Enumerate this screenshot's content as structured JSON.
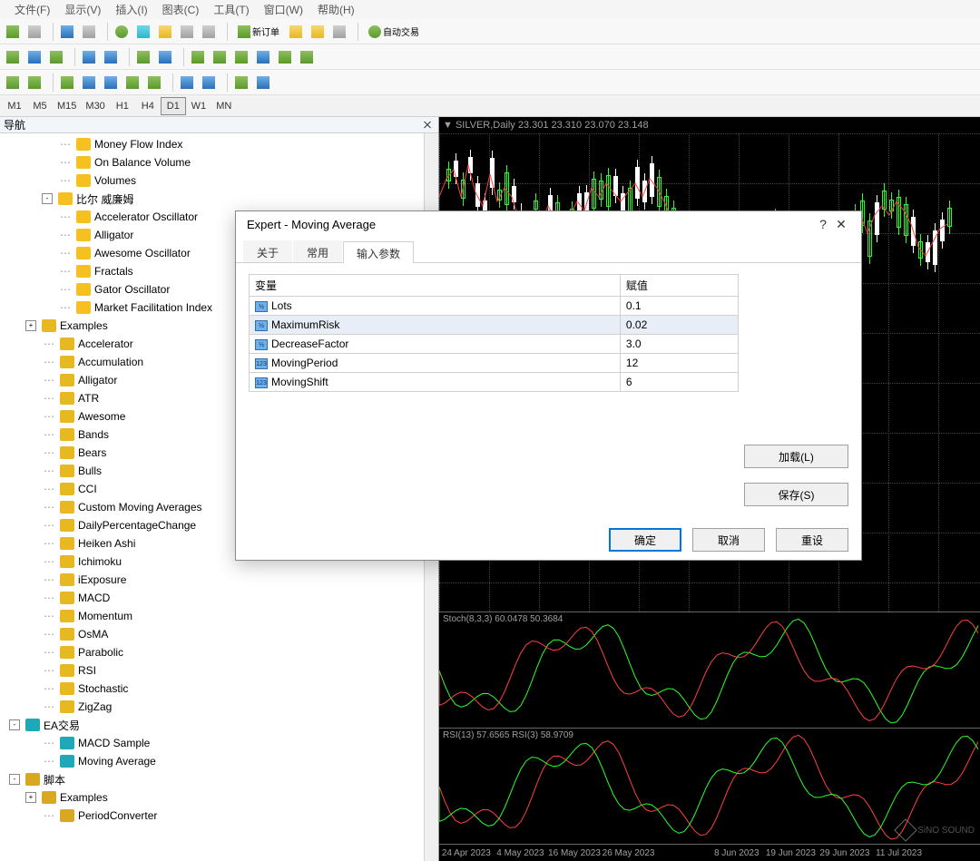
{
  "menu": {
    "items": [
      "文件(F)",
      "显示(V)",
      "插入(I)",
      "图表(C)",
      "工具(T)",
      "窗口(W)",
      "帮助(H)"
    ]
  },
  "toolbar": {
    "row1": [
      {
        "name": "new-chart-icon",
        "glyph": "greenish"
      },
      {
        "name": "dropdown-icon",
        "glyph": "grayish"
      },
      {
        "sep": true
      },
      {
        "name": "save-icon",
        "glyph": "bluish"
      },
      {
        "name": "dropdown2-icon",
        "glyph": "grayish"
      },
      {
        "sep": true
      },
      {
        "name": "profile-icon",
        "glyph": "greenish"
      },
      {
        "name": "marketwatch-icon",
        "glyph": "cyanish"
      },
      {
        "name": "navigator-icon",
        "glyph": "yellowish"
      },
      {
        "name": "terminal-icon",
        "glyph": "grayish"
      },
      {
        "name": "tester-icon",
        "glyph": "grayish"
      },
      {
        "sep": true
      },
      {
        "name": "new-order-icon",
        "glyph": "greenish",
        "label": "新订单"
      },
      {
        "name": "meta-editor-icon",
        "glyph": "yellowish"
      },
      {
        "name": "options-icon",
        "glyph": "yellowish"
      },
      {
        "name": "fullscreen-icon",
        "glyph": "grayish"
      },
      {
        "sep": true
      },
      {
        "name": "autotrade-icon",
        "glyph": "greenish",
        "label": "自动交易"
      }
    ],
    "row2_names": [
      "bar-chart-icon",
      "candle-chart-icon",
      "line-chart-icon",
      "sep",
      "zoom-in-icon",
      "zoom-out-icon",
      "sep",
      "auto-scroll-icon",
      "shift-icon",
      "sep",
      "indicators-icon",
      "periods-icon",
      "templates-icon",
      "dd1",
      "dd2",
      "dd3"
    ],
    "row3_names": [
      "cursor-icon",
      "crosshair-icon",
      "sep2",
      "vline-icon",
      "hline-icon",
      "trendline-icon",
      "equidistant-icon",
      "fibo-icon",
      "sep2",
      "text-icon",
      "textlabel-icon",
      "sep2",
      "arrows-icon",
      "dd"
    ]
  },
  "timeframes": {
    "items": [
      "M1",
      "M5",
      "M15",
      "M30",
      "H1",
      "H4",
      "D1",
      "W1",
      "MN"
    ],
    "active": "D1"
  },
  "nav": {
    "title": "导航",
    "groups": [
      {
        "depth": 3,
        "icon": "f-yellow",
        "label": "Money Flow Index"
      },
      {
        "depth": 3,
        "icon": "f-yellow",
        "label": "On Balance Volume"
      },
      {
        "depth": 3,
        "icon": "f-yellow",
        "label": "Volumes"
      },
      {
        "depth": 2,
        "exp": "-",
        "icon": "f-yellow",
        "label": "比尔 威廉姆"
      },
      {
        "depth": 3,
        "icon": "f-yellow",
        "label": "Accelerator Oscillator"
      },
      {
        "depth": 3,
        "icon": "f-yellow",
        "label": "Alligator"
      },
      {
        "depth": 3,
        "icon": "f-yellow",
        "label": "Awesome Oscillator"
      },
      {
        "depth": 3,
        "icon": "f-yellow",
        "label": "Fractals"
      },
      {
        "depth": 3,
        "icon": "f-yellow",
        "label": "Gator Oscillator"
      },
      {
        "depth": 3,
        "icon": "f-yellow",
        "label": "Market Facilitation Index"
      },
      {
        "depth": 1,
        "exp": "+",
        "icon": "f-gold",
        "label": "Examples"
      },
      {
        "depth": 2,
        "icon": "f-gold",
        "label": "Accelerator"
      },
      {
        "depth": 2,
        "icon": "f-gold",
        "label": "Accumulation"
      },
      {
        "depth": 2,
        "icon": "f-gold",
        "label": "Alligator"
      },
      {
        "depth": 2,
        "icon": "f-gold",
        "label": "ATR"
      },
      {
        "depth": 2,
        "icon": "f-gold",
        "label": "Awesome"
      },
      {
        "depth": 2,
        "icon": "f-gold",
        "label": "Bands"
      },
      {
        "depth": 2,
        "icon": "f-gold",
        "label": "Bears"
      },
      {
        "depth": 2,
        "icon": "f-gold",
        "label": "Bulls"
      },
      {
        "depth": 2,
        "icon": "f-gold",
        "label": "CCI"
      },
      {
        "depth": 2,
        "icon": "f-gold",
        "label": "Custom Moving Averages"
      },
      {
        "depth": 2,
        "icon": "f-gold",
        "label": "DailyPercentageChange"
      },
      {
        "depth": 2,
        "icon": "f-gold",
        "label": "Heiken Ashi"
      },
      {
        "depth": 2,
        "icon": "f-gold",
        "label": "Ichimoku"
      },
      {
        "depth": 2,
        "icon": "f-gold",
        "label": "iExposure"
      },
      {
        "depth": 2,
        "icon": "f-gold",
        "label": "MACD"
      },
      {
        "depth": 2,
        "icon": "f-gold",
        "label": "Momentum"
      },
      {
        "depth": 2,
        "icon": "f-gold",
        "label": "OsMA"
      },
      {
        "depth": 2,
        "icon": "f-gold",
        "label": "Parabolic"
      },
      {
        "depth": 2,
        "icon": "f-gold",
        "label": "RSI"
      },
      {
        "depth": 2,
        "icon": "f-gold",
        "label": "Stochastic"
      },
      {
        "depth": 2,
        "icon": "f-gold",
        "label": "ZigZag"
      },
      {
        "depth": 0,
        "exp": "-",
        "icon": "f-teal",
        "label": "EA交易"
      },
      {
        "depth": 2,
        "icon": "f-teal",
        "label": "MACD Sample"
      },
      {
        "depth": 2,
        "icon": "f-teal",
        "label": "Moving Average"
      },
      {
        "depth": 0,
        "exp": "-",
        "icon": "f-script",
        "label": "脚本"
      },
      {
        "depth": 1,
        "exp": "+",
        "icon": "f-script",
        "label": "Examples"
      },
      {
        "depth": 2,
        "icon": "f-script",
        "label": "PeriodConverter"
      }
    ]
  },
  "chart": {
    "header": "▼ SILVER,Daily  23.301 23.310 23.070 23.148",
    "stoch_label": "Stoch(8,3,3) 60.0478 50.3684",
    "rsi_label": "RSI(13) 57.6565   RSI(3) 58.9709",
    "time_ticks": [
      "24 Apr 2023",
      "4 May 2023",
      "16 May 2023",
      "26 May 2023",
      "",
      "8 Jun 2023",
      "19 Jun 2023",
      "29 Jun 2023",
      "11 Jul 2023",
      ""
    ],
    "watermark": "SiNO SOUND"
  },
  "dialog": {
    "title": "Expert - Moving Average",
    "tabs": [
      "关于",
      "常用",
      "输入参数"
    ],
    "active_tab": 2,
    "columns": [
      "变量",
      "赋值"
    ],
    "params": [
      {
        "icon": "1/a",
        "name": "Lots",
        "value": "0.1"
      },
      {
        "icon": "1/a",
        "name": "MaximumRisk",
        "value": "0.02",
        "sel": true
      },
      {
        "icon": "1/a",
        "name": "DecreaseFactor",
        "value": "3.0"
      },
      {
        "icon": "123",
        "name": "MovingPeriod",
        "value": "12"
      },
      {
        "icon": "123",
        "name": "MovingShift",
        "value": "6"
      }
    ],
    "buttons": {
      "load": "加载(L)",
      "save": "保存(S)",
      "ok": "确定",
      "cancel": "取消",
      "reset": "重设"
    }
  },
  "chart_data": {
    "type": "candlestick",
    "symbol": "SILVER",
    "timeframe": "Daily",
    "ohlc_last": {
      "open": 23.301,
      "high": 23.31,
      "low": 23.07,
      "close": 23.148
    },
    "indicators": [
      {
        "name": "Moving Average",
        "color": "#ff4040"
      },
      {
        "name": "Stoch",
        "params": [
          8,
          3,
          3
        ],
        "values": [
          60.0478,
          50.3684
        ],
        "colors": [
          "#2aff2a",
          "#ff4040"
        ]
      },
      {
        "name": "RSI",
        "params": [
          13
        ],
        "value": 57.6565,
        "color": "#ff4040"
      },
      {
        "name": "RSI",
        "params": [
          3
        ],
        "value": 58.9709,
        "color": "#2aff2a"
      }
    ],
    "x_ticks": [
      "24 Apr 2023",
      "4 May 2023",
      "16 May 2023",
      "26 May 2023",
      "8 Jun 2023",
      "19 Jun 2023",
      "29 Jun 2023",
      "11 Jul 2023"
    ]
  }
}
